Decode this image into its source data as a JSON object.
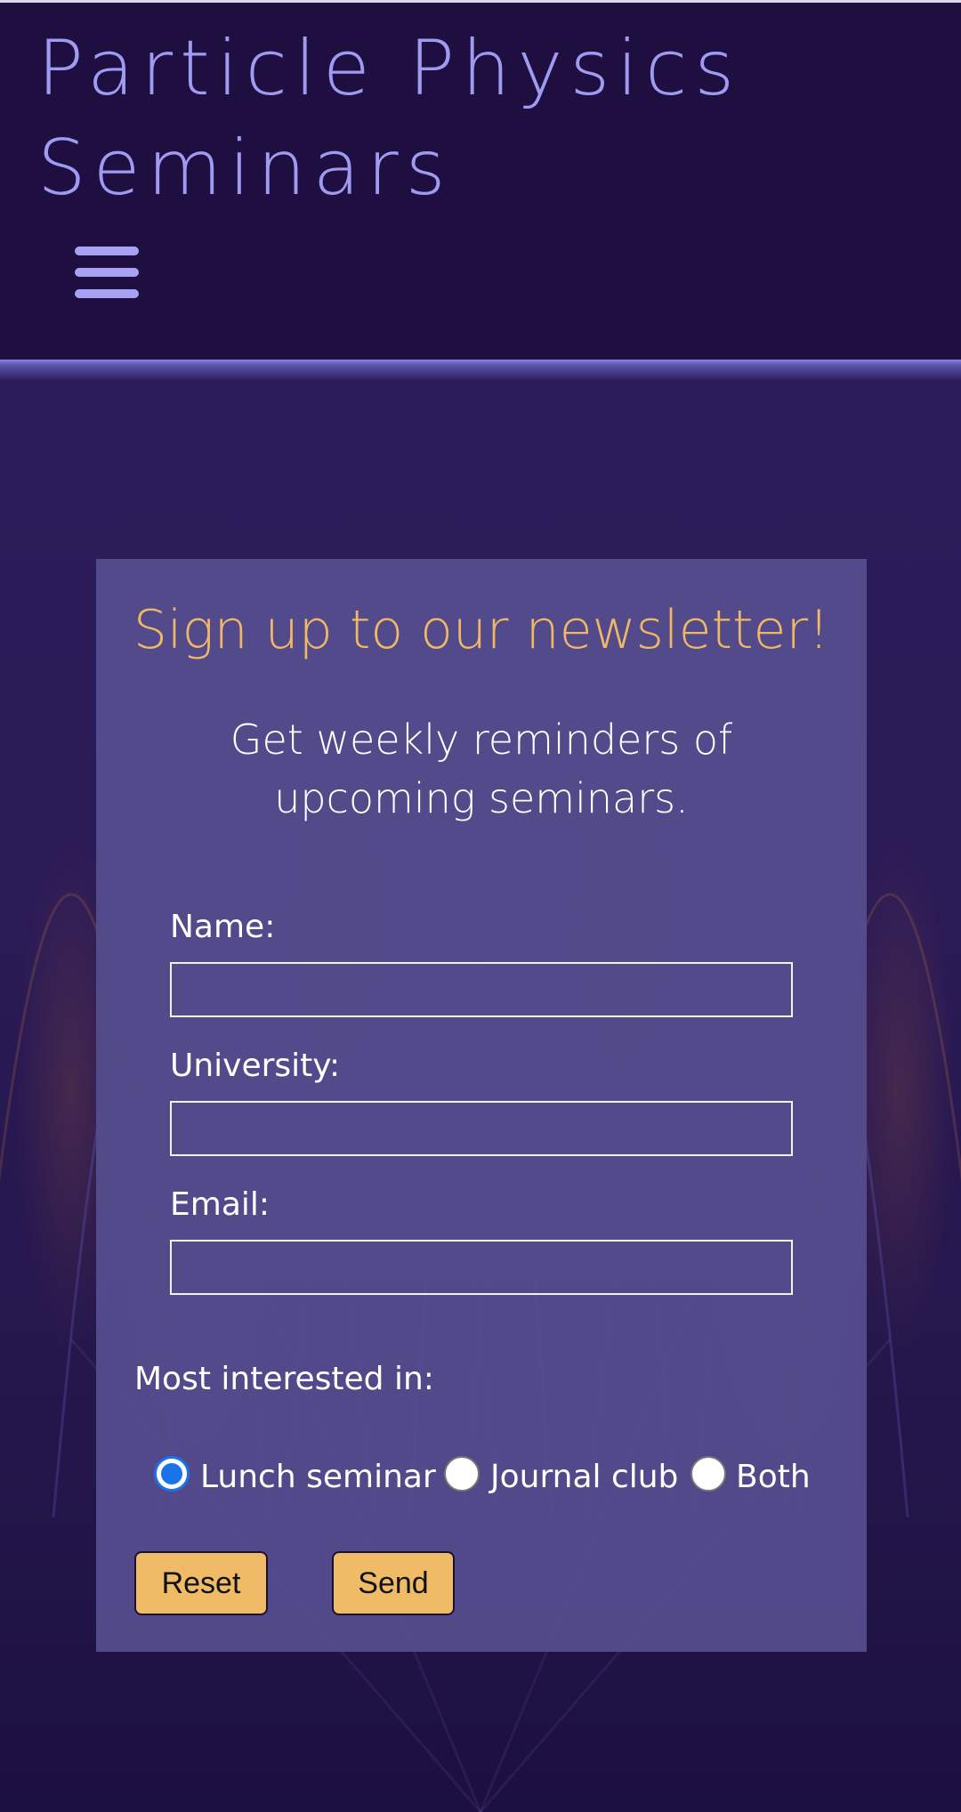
{
  "header": {
    "title": "Particle Physics Seminars",
    "menu_icon": "hamburger-menu-icon"
  },
  "colors": {
    "header_bg": "#1e0f40",
    "title": "#9f9bf2",
    "card_bg": "#544c8c",
    "accent": "#f0b866",
    "button_bg": "#f0bb66",
    "radio_checked": "#1a73e8"
  },
  "signup": {
    "title": "Sign up to our newsletter!",
    "subtitle": "Get weekly reminders of upcoming seminars.",
    "fields": {
      "name_label": "Name:",
      "name_value": "",
      "university_label": "University:",
      "university_value": "",
      "email_label": "Email:",
      "email_value": ""
    },
    "interest": {
      "label": "Most interested in:",
      "options": [
        "Lunch seminar",
        "Journal club",
        "Both"
      ],
      "selected": "Lunch seminar"
    },
    "buttons": {
      "reset": "Reset",
      "send": "Send"
    }
  }
}
